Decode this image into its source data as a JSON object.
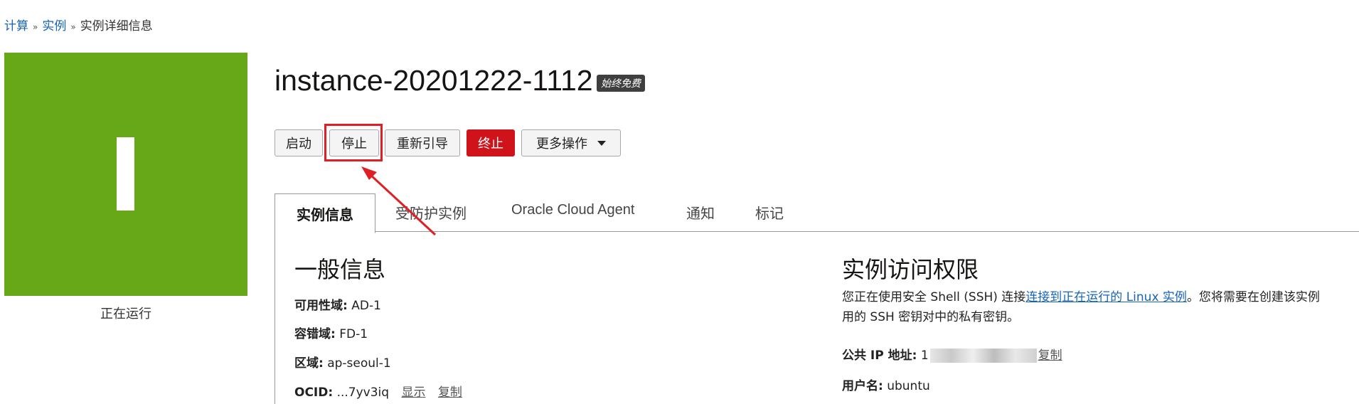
{
  "breadcrumb": {
    "items": [
      "计算",
      "实例"
    ],
    "current": "实例详细信息",
    "separator": "»"
  },
  "status": {
    "letter": "I",
    "label": "正在运行",
    "color": "#67a819"
  },
  "instance": {
    "title": "instance-20201222-1112",
    "badge": "始终免费"
  },
  "actions": {
    "start": "启动",
    "stop": "停止",
    "reboot": "重新引导",
    "terminate": "终止",
    "more": "更多操作"
  },
  "tabs": [
    "实例信息",
    "受防护实例",
    "Oracle Cloud Agent",
    "通知",
    "标记"
  ],
  "general": {
    "heading": "一般信息",
    "availability_domain": {
      "key": "可用性域:",
      "value": "AD-1"
    },
    "fault_domain": {
      "key": "容错域:",
      "value": "FD-1"
    },
    "region": {
      "key": "区域:",
      "value": "ap-seoul-1"
    },
    "ocid": {
      "key": "OCID:",
      "value": "...7yv3iq",
      "show": "显示",
      "copy": "复制"
    }
  },
  "access": {
    "heading": "实例访问权限",
    "para_prefix": "您正在使用安全 Shell (SSH) 连接",
    "para_link": "连接到正在运行的 Linux 实例",
    "para_suffix": "。您将需要在创建该实例",
    "para_line2": "用的 SSH 密钥对中的私有密钥。",
    "public_ip": {
      "key": "公共 IP 地址:",
      "value_start": "1",
      "copy": "复制"
    },
    "username": {
      "key": "用户名:",
      "value": "ubuntu"
    }
  },
  "colors": {
    "highlight": "#e01f24",
    "terminate": "#d0121b",
    "link": "#1564b8"
  }
}
